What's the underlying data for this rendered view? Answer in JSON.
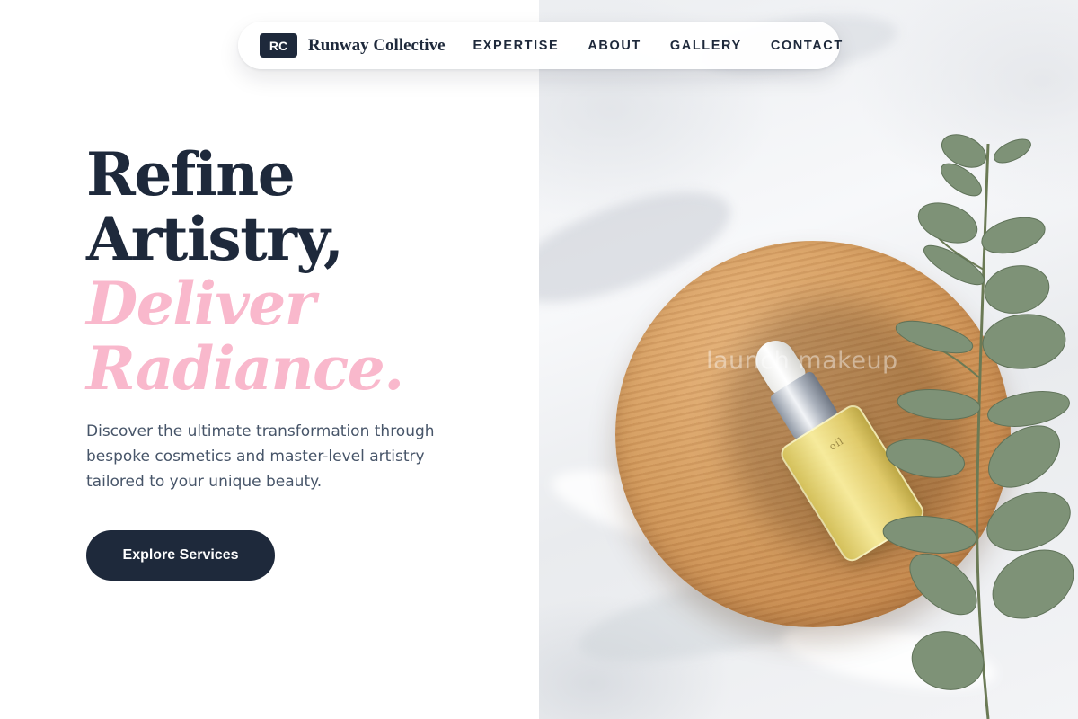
{
  "nav": {
    "brand_mark": "RC",
    "brand_name": "Runway Collective",
    "links": [
      {
        "label": "EXPERTISE"
      },
      {
        "label": "ABOUT"
      },
      {
        "label": "GALLERY"
      },
      {
        "label": "CONTACT"
      }
    ]
  },
  "hero": {
    "headline_line1": "Refine",
    "headline_line2": "Artistry,",
    "headline_accent1": "Deliver",
    "headline_accent2": "Radiance.",
    "description": "Discover the ultimate transformation through bespoke cosmetics and master-level artistry tailored to your unique beauty.",
    "cta_label": "Explore Services"
  },
  "image": {
    "watermark": "launch makeup",
    "subject_icon": "serum-bottle-on-wood-board-with-eucalyptus"
  },
  "colors": {
    "primary": "#1e293b",
    "accent_pink": "#f9b8cc",
    "body_text": "#475569",
    "background": "#ffffff"
  }
}
